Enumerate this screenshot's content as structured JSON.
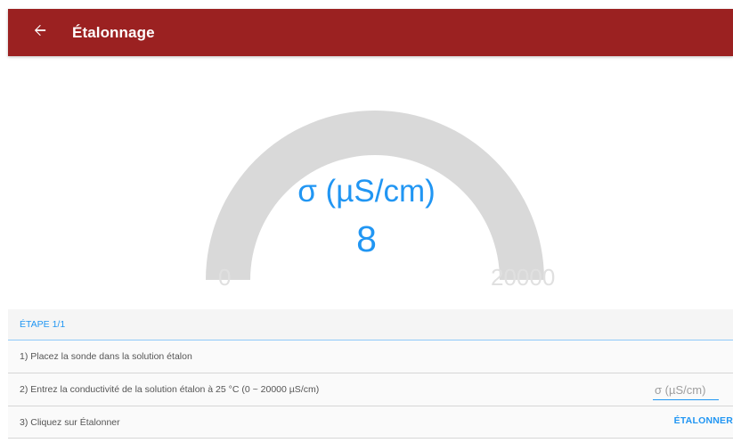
{
  "appbar": {
    "title": "Étalonnage",
    "back_icon": "arrow-left-icon",
    "background_color": "#9b2121"
  },
  "gauge": {
    "unit_label": "σ (µS/cm)",
    "value": "8",
    "min_label": "0",
    "max_label": "20000",
    "min": 0,
    "max": 20000,
    "current": 8,
    "accent_color": "#2196f3",
    "track_color": "#d9d9d9"
  },
  "steps": {
    "header": "ÉTAPE 1/1",
    "step1": "1) Placez la sonde dans la solution étalon",
    "step2": "2) Entrez la conductivité de la solution étalon à 25 °C (0 ~ 20000 µS/cm)",
    "step2_placeholder": "σ (µS/cm)",
    "step3": "3) Cliquez sur Étalonner",
    "calibrate_button": "ÉTALONNER"
  }
}
